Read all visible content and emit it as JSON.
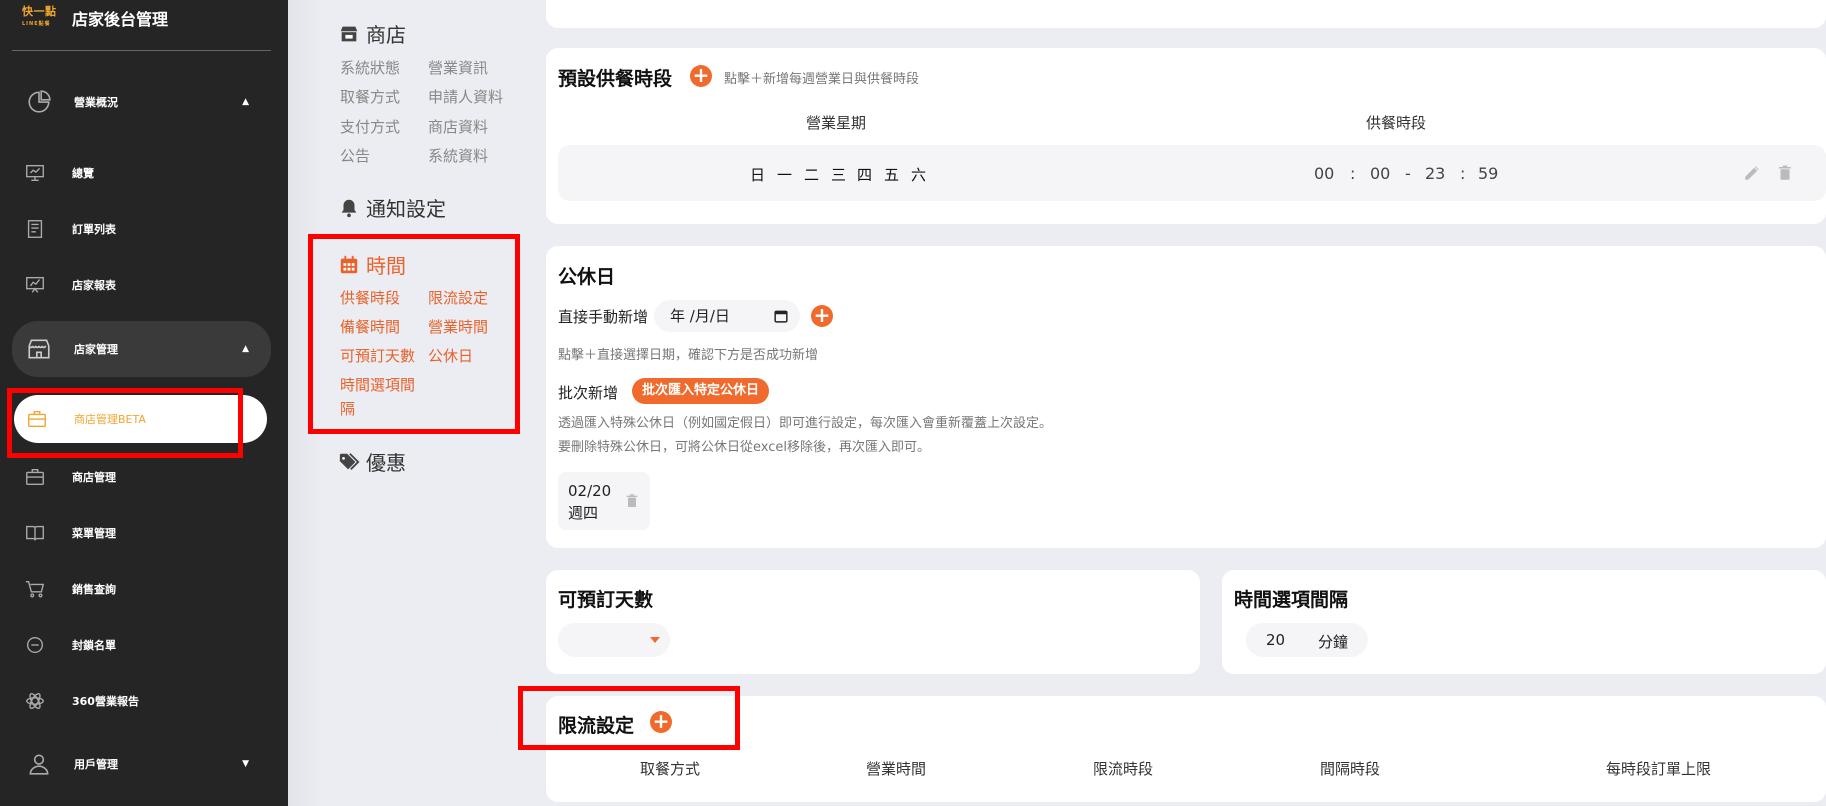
{
  "brand": {
    "logo_main": "快一點",
    "logo_sub": "LINE點餐",
    "title": "店家後台管理"
  },
  "sidebar": {
    "items": [
      {
        "label": "營業概況",
        "icon": "pie-chart-icon",
        "caret": "▲"
      },
      {
        "label": "總覽",
        "icon": "presentation-icon"
      },
      {
        "label": "訂單列表",
        "icon": "receipt-icon"
      },
      {
        "label": "店家報表",
        "icon": "chart-board-icon"
      },
      {
        "label": "店家管理",
        "icon": "store-icon",
        "caret": "▲"
      },
      {
        "label": "商店管理BETA",
        "icon": "briefcase-icon"
      },
      {
        "label": "商店管理",
        "icon": "briefcase-icon"
      },
      {
        "label": "菜單管理",
        "icon": "book-icon"
      },
      {
        "label": "銷售查詢",
        "icon": "cart-icon"
      },
      {
        "label": "封鎖名單",
        "icon": "minus-circle-icon"
      },
      {
        "label": "360營業報告",
        "icon": "atom-icon"
      },
      {
        "label": "用戶管理",
        "icon": "user-icon",
        "caret": "▼"
      }
    ]
  },
  "submenu": {
    "shop_title": "商店",
    "shop_links": [
      "系統狀態",
      "營業資訊",
      "取餐方式",
      "申請人資料",
      "支付方式",
      "商店資料",
      "公告",
      "系統資料"
    ],
    "notify_title": "通知設定",
    "time_title": "時間",
    "time_links": [
      "供餐時段",
      "限流設定",
      "備餐時間",
      "營業時間",
      "可預訂天數",
      "公休日",
      "時間選項間",
      "隔"
    ],
    "promo_title": "優惠"
  },
  "default_slots": {
    "title": "預設供餐時段",
    "hint": "點擊＋新增每週營業日與供餐時段",
    "col_weekday": "營業星期",
    "col_time": "供餐時段",
    "days": [
      "日",
      "一",
      "二",
      "三",
      "四",
      "五",
      "六"
    ],
    "time": {
      "h1": "00",
      "sep1": ":",
      "m1": "00",
      "dash": "-",
      "h2": "23",
      "sep2": ":",
      "m2": "59"
    }
  },
  "holiday": {
    "title": "公休日",
    "manual_label": "直接手動新增",
    "date_placeholder": "年 /月/日",
    "manual_hint": "點擊＋直接選擇日期，確認下方是否成功新增",
    "batch_label": "批次新增",
    "batch_button": "批次匯入特定公休日",
    "batch_hint1": "透過匯入特殊公休日（例如國定假日）即可進行設定，每次匯入會重新覆蓋上次設定。",
    "batch_hint2": "要刪除特殊公休日，可將公休日從excel移除後，再次匯入即可。",
    "entries": [
      {
        "date": "02/20",
        "weekday": "週四"
      }
    ]
  },
  "bookable_days": {
    "title": "可預訂天數"
  },
  "time_interval": {
    "title": "時間選項間隔",
    "value": "20",
    "unit": "分鐘"
  },
  "rate_limit": {
    "title": "限流設定",
    "columns": [
      "取餐方式",
      "營業時間",
      "限流時段",
      "間隔時段",
      "每時段訂單上限"
    ]
  },
  "colors": {
    "accent": "#ef6a2c",
    "sidebar_bg": "#252525",
    "highlight": "#f0a52e",
    "annotation": "#ff0000"
  }
}
